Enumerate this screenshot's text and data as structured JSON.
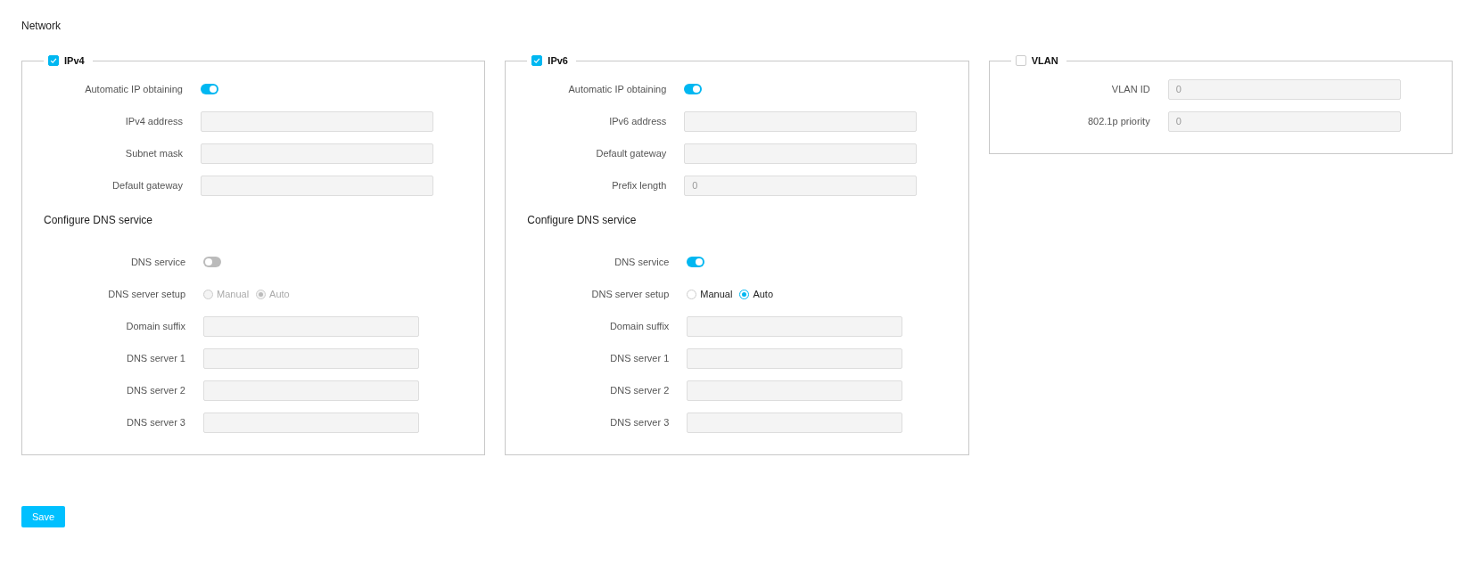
{
  "page_title": "Network",
  "panels": [
    {
      "title": "IPv4",
      "checked": true,
      "rows": [
        {
          "kind": "toggle",
          "label": "Automatic IP obtaining",
          "on": true
        },
        {
          "kind": "field",
          "label": "IPv4 address"
        },
        {
          "kind": "field",
          "label": "Subnet mask"
        },
        {
          "kind": "field",
          "label": "Default gateway"
        }
      ],
      "dns": {
        "heading": "Configure DNS service",
        "rows": [
          {
            "kind": "toggle",
            "label": "DNS service",
            "on": false
          },
          {
            "kind": "radio",
            "label": "DNS server setup",
            "disabled": true,
            "options": [
              {
                "label": "Manual",
                "selected": false
              },
              {
                "label": "Auto",
                "selected": true
              }
            ]
          },
          {
            "kind": "field",
            "label": "Domain suffix"
          },
          {
            "kind": "field",
            "label": "DNS server 1"
          },
          {
            "kind": "field",
            "label": "DNS server 2"
          },
          {
            "kind": "field",
            "label": "DNS server 3"
          }
        ]
      }
    },
    {
      "title": "IPv6",
      "checked": true,
      "rows": [
        {
          "kind": "toggle",
          "label": "Automatic IP obtaining",
          "on": true
        },
        {
          "kind": "field",
          "label": "IPv6 address"
        },
        {
          "kind": "field",
          "label": "Default gateway"
        },
        {
          "kind": "field",
          "label": "Prefix length",
          "value": "0"
        }
      ],
      "dns": {
        "heading": "Configure DNS service",
        "rows": [
          {
            "kind": "toggle",
            "label": "DNS service",
            "on": true
          },
          {
            "kind": "radio",
            "label": "DNS server setup",
            "disabled": false,
            "options": [
              {
                "label": "Manual",
                "selected": false
              },
              {
                "label": "Auto",
                "selected": true
              }
            ]
          },
          {
            "kind": "field",
            "label": "Domain suffix"
          },
          {
            "kind": "field",
            "label": "DNS server 1"
          },
          {
            "kind": "field",
            "label": "DNS server 2"
          },
          {
            "kind": "field",
            "label": "DNS server 3"
          }
        ]
      }
    },
    {
      "title": "VLAN",
      "checked": false,
      "rows": [
        {
          "kind": "field",
          "label": "VLAN ID",
          "value": "0"
        },
        {
          "kind": "field",
          "label": "802.1p priority",
          "value": "0"
        }
      ]
    }
  ],
  "save_button": "Save"
}
